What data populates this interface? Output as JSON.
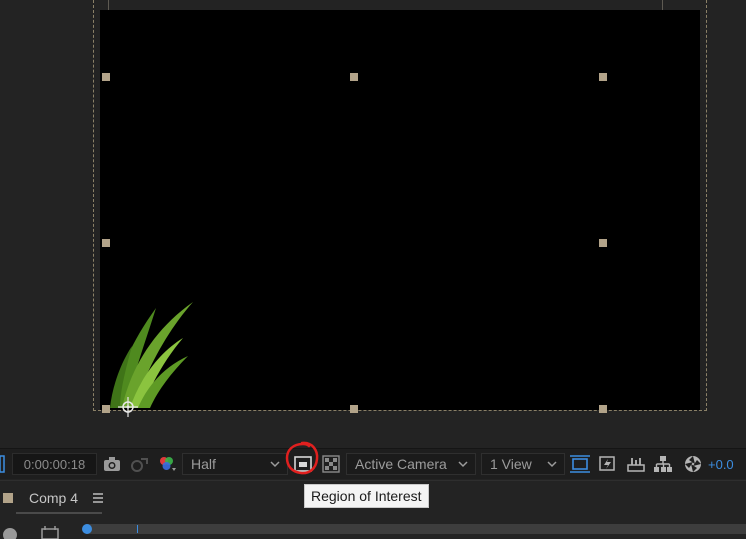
{
  "viewer": {
    "canvas_color": "#000000",
    "handle_color": "#b2a389"
  },
  "toolbar": {
    "timecode": "0:00:00:18",
    "resolution": {
      "selected": "Half"
    },
    "camera": {
      "selected": "Active Camera"
    },
    "views": {
      "selected": "1 View"
    },
    "exposure": "+0.0",
    "icons": [
      "snapshot-icon",
      "show-snapshot-icon",
      "channel-icon",
      "region-of-interest-icon",
      "transparency-grid-icon",
      "fast-previews-icon",
      "flowchart-icon",
      "timeline-icon",
      "reset-exposure-icon"
    ],
    "accent": "#3c8de0"
  },
  "tooltip": {
    "text": "Region of Interest"
  },
  "timeline": {
    "tab_label": "Comp 4",
    "label_color": "#b2a389"
  },
  "annotation": {
    "color": "#e0201f"
  }
}
